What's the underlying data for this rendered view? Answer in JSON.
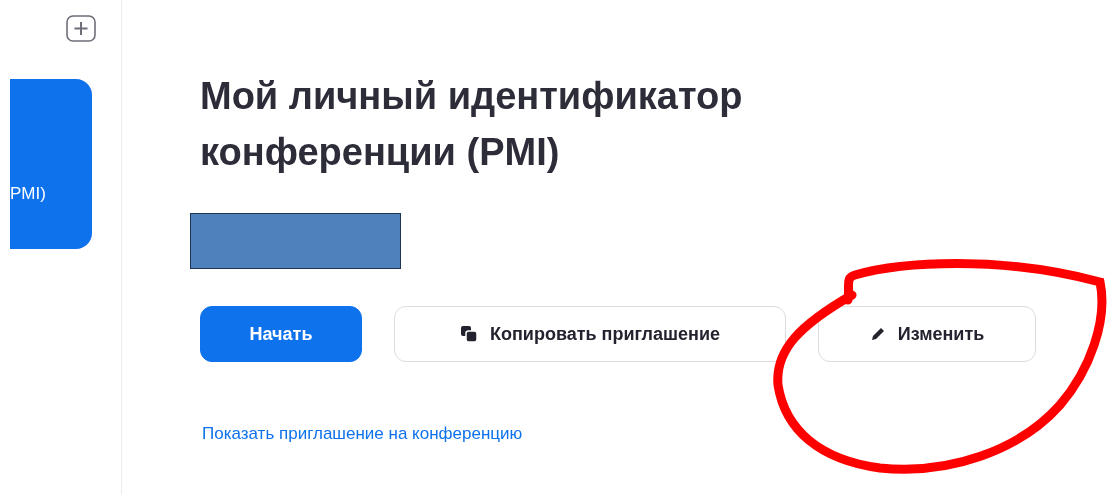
{
  "sidebar": {
    "tile_label": "PMI)"
  },
  "pmi": {
    "title": "Мой личный идентификатор конференции (PMI)",
    "buttons": [
      {
        "kind": "primary",
        "label": "Начать"
      },
      {
        "kind": "copy",
        "label": "Копировать приглашение"
      },
      {
        "kind": "edit",
        "label": "Изменить"
      }
    ],
    "link": "Показать приглашение на конференцию"
  }
}
